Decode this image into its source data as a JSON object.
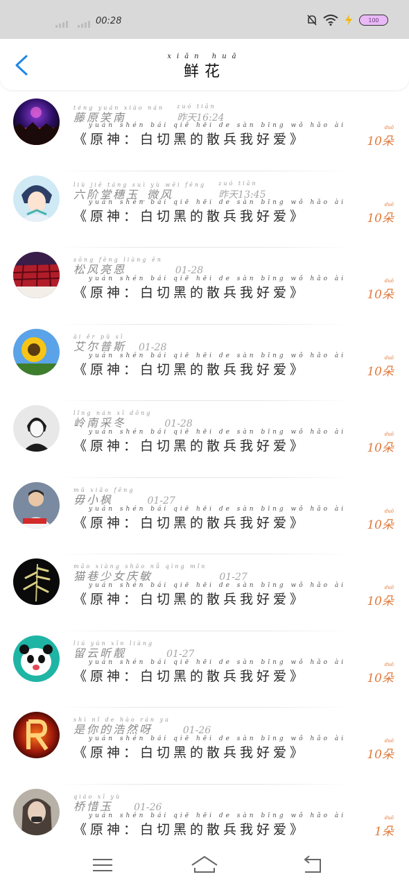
{
  "status_bar": {
    "time": "00:28",
    "battery": "100"
  },
  "header": {
    "title_pinyin": "xiān huā",
    "title": "鲜花"
  },
  "items": [
    {
      "name_pinyin": "téng yuán xiào nán",
      "name": "藤原笑南",
      "time_pinyin": "zuó tiān",
      "time": "昨天16:24",
      "msg_pinyin": "yuán shén    bái qiē hēi de sàn bīng wǒ hǎo ài",
      "message": "《原神：白切黑的散兵我好爱》",
      "count_pinyin": "duǒ",
      "count": "10朵"
    },
    {
      "name_pinyin": "liù jiē táng suì yù wēi fēng",
      "name": "六阶堂穗玉_微风",
      "time_pinyin": "zuó tiān",
      "time": "昨天13:45",
      "msg_pinyin": "yuán shén    bái qiē hēi de sàn bīng wǒ hǎo ài",
      "message": "《原神：白切黑的散兵我好爱》",
      "count_pinyin": "duǒ",
      "count": "10朵"
    },
    {
      "name_pinyin": "sōng fēng liàng ēn",
      "name": "松风亮恩",
      "time_pinyin": "",
      "time": "01-28",
      "msg_pinyin": "yuán shén    bái qiē hēi de sàn bīng wǒ hǎo ài",
      "message": "《原神：白切黑的散兵我好爱》",
      "count_pinyin": "duǒ",
      "count": "10朵"
    },
    {
      "name_pinyin": "ài ěr pǔ sī",
      "name": "艾尔普斯",
      "time_pinyin": "",
      "time": "01-28",
      "msg_pinyin": "yuán shén    bái qiē hēi de sàn bīng wǒ hǎo ài",
      "message": "《原神：白切黑的散兵我好爱》",
      "count_pinyin": "duǒ",
      "count": "10朵"
    },
    {
      "name_pinyin": "lǐng nán xī dōng",
      "name": "岭南采冬",
      "time_pinyin": "",
      "time": "01-28",
      "msg_pinyin": "yuán shén    bái qiē hēi de sàn bīng wǒ hǎo ài",
      "message": "《原神：白切黑的散兵我好爱》",
      "count_pinyin": "duǒ",
      "count": "10朵"
    },
    {
      "name_pinyin": "mǔ xiǎo fēng",
      "name": "毋小枫",
      "time_pinyin": "",
      "time": "01-27",
      "msg_pinyin": "yuán shén    bái qiē hēi de sàn bīng wǒ hǎo ài",
      "message": "《原神：白切黑的散兵我好爱》",
      "count_pinyin": "duǒ",
      "count": "10朵"
    },
    {
      "name_pinyin": "māo xiàng shǎo nǚ qìng mǐn",
      "name": "猫巷少女庆敏",
      "time_pinyin": "",
      "time": "01-27",
      "msg_pinyin": "yuán shén    bái qiē hēi de sàn bīng wǒ hǎo ài",
      "message": "《原神：白切黑的散兵我好爱》",
      "count_pinyin": "duǒ",
      "count": "10朵"
    },
    {
      "name_pinyin": "liú yún xīn liàng",
      "name": "留云昕靓",
      "time_pinyin": "",
      "time": "01-27",
      "msg_pinyin": "yuán shén    bái qiē hēi de sàn bīng wǒ hǎo ài",
      "message": "《原神：白切黑的散兵我好爱》",
      "count_pinyin": "duǒ",
      "count": "10朵"
    },
    {
      "name_pinyin": "shì nǐ de hào rán ya",
      "name": "是你的浩然呀",
      "time_pinyin": "",
      "time": "01-26",
      "msg_pinyin": "yuán shén    bái qiē hēi de sàn bīng wǒ hǎo ài",
      "message": "《原神：白切黑的散兵我好爱》",
      "count_pinyin": "duǒ",
      "count": "10朵"
    },
    {
      "name_pinyin": "qiáo xī yù",
      "name": "桥惜玉",
      "time_pinyin": "",
      "time": "01-26",
      "msg_pinyin": "yuán shén    bái qiē hēi de sàn bīng wǒ hǎo ài",
      "message": "《原神：白切黑的散兵我好爱》",
      "count_pinyin": "duǒ",
      "count": "1朵"
    }
  ],
  "avatar_icons": [
    "concert-crowd-avatar",
    "anime-boy-avatar",
    "red-skirt-avatar",
    "sunflower-avatar",
    "anime-sketch-boy-avatar",
    "photo-person-avatar",
    "bamboo-avatar",
    "panda-avatar",
    "letter-r-avatar",
    "girl-portrait-avatar"
  ],
  "colors": {
    "accent_blue": "#1e88e5",
    "count_orange": "#e07a3c"
  }
}
